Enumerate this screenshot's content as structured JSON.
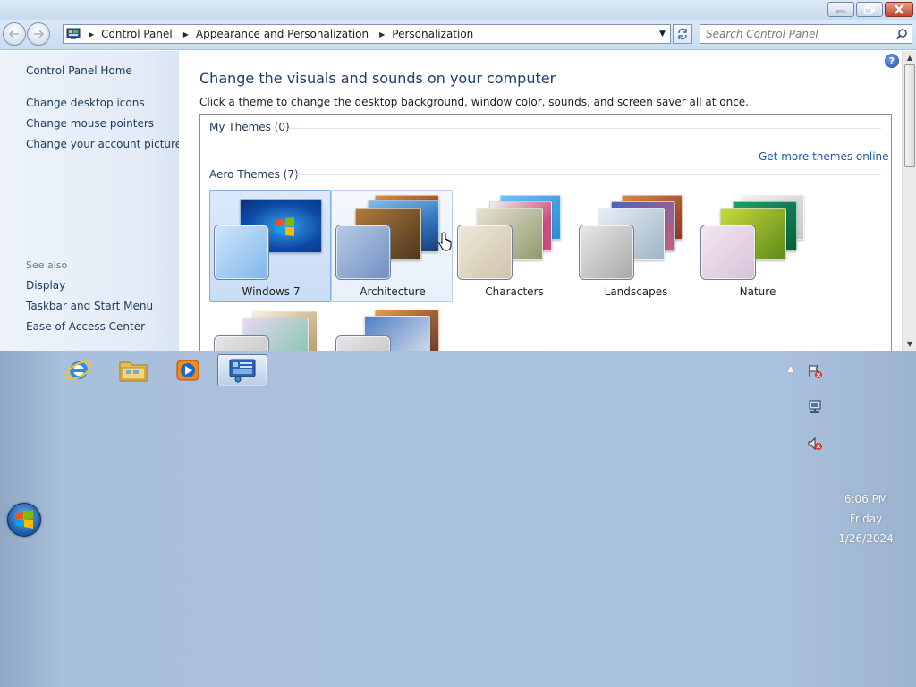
{
  "window": {
    "caption_buttons": {
      "minimize": "minimize",
      "maximize": "restore",
      "close": "close"
    }
  },
  "address": {
    "crumbs": [
      "Control Panel",
      "Appearance and Personalization",
      "Personalization"
    ]
  },
  "search": {
    "placeholder": "Search Control Panel"
  },
  "sidebar": {
    "home": "Control Panel Home",
    "tasks": [
      "Change desktop icons",
      "Change mouse pointers",
      "Change your account picture"
    ],
    "see_also_heading": "See also",
    "see_also": [
      "Display",
      "Taskbar and Start Menu",
      "Ease of Access Center"
    ]
  },
  "main": {
    "title": "Change the visuals and sounds on your computer",
    "description": "Click a theme to change the desktop background, window color, sounds, and screen saver all at once.",
    "my_themes_heading": "My Themes (0)",
    "get_more_link": "Get more themes online",
    "aero_heading": "Aero Themes (7)",
    "themes": [
      {
        "label": "Windows 7",
        "state": "selected"
      },
      {
        "label": "Architecture",
        "state": "hover"
      },
      {
        "label": "Characters",
        "state": "normal"
      },
      {
        "label": "Landscapes",
        "state": "normal"
      },
      {
        "label": "Nature",
        "state": "normal"
      }
    ]
  },
  "taskbar": {
    "pinned": [
      "internet-explorer-icon",
      "windows-explorer-icon",
      "media-player-icon",
      "personalization-icon"
    ],
    "active": "personalization-icon"
  },
  "tray": {
    "icons": [
      "action-center-icon",
      "network-icon",
      "volume-muted-icon"
    ],
    "time": "6:06 PM",
    "day": "Friday",
    "date": "1/26/2024"
  },
  "colors": {
    "accent_link": "#1e395b",
    "title_blue": "#1e3c6e",
    "selection": "#c9ddf6"
  }
}
